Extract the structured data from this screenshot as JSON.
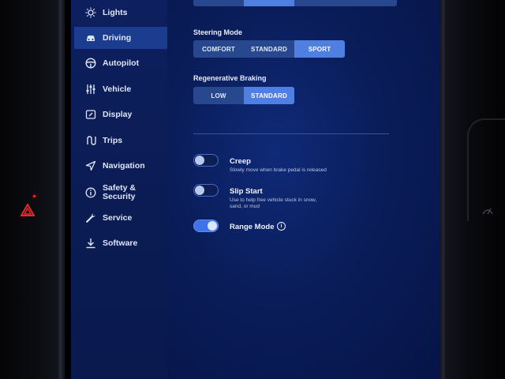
{
  "sidebar": {
    "items": [
      {
        "label": "Lights",
        "icon": "sun-icon"
      },
      {
        "label": "Driving",
        "icon": "car-icon"
      },
      {
        "label": "Autopilot",
        "icon": "steering-wheel-icon"
      },
      {
        "label": "Vehicle",
        "icon": "sliders-icon"
      },
      {
        "label": "Display",
        "icon": "display-icon"
      },
      {
        "label": "Trips",
        "icon": "route-icon"
      },
      {
        "label": "Navigation",
        "icon": "navigation-arrow-icon"
      },
      {
        "label": "Safety &\nSecurity",
        "icon": "info-circle-icon"
      },
      {
        "label": "Service",
        "icon": "wrench-icon"
      },
      {
        "label": "Software",
        "icon": "download-icon"
      }
    ],
    "active": "Driving"
  },
  "steering": {
    "label": "Steering Mode",
    "options": [
      "COMFORT",
      "STANDARD",
      "SPORT"
    ],
    "selected": "SPORT"
  },
  "regen": {
    "label": "Regenerative Braking",
    "options": [
      "LOW",
      "STANDARD"
    ],
    "selected": "STANDARD"
  },
  "options": {
    "creep": {
      "title": "Creep",
      "desc": "Slowly move when brake pedal is released",
      "on": false
    },
    "slip": {
      "title": "Slip Start",
      "desc": "Use to help free vehicle stuck in snow,\nsand, or mud",
      "on": false
    },
    "range": {
      "title": "Range Mode",
      "on": true,
      "info": "i"
    }
  },
  "colors": {
    "accent": "#4f7fe0",
    "sidebar_active": "#1b3c8f",
    "hazard": "#e8282a"
  }
}
